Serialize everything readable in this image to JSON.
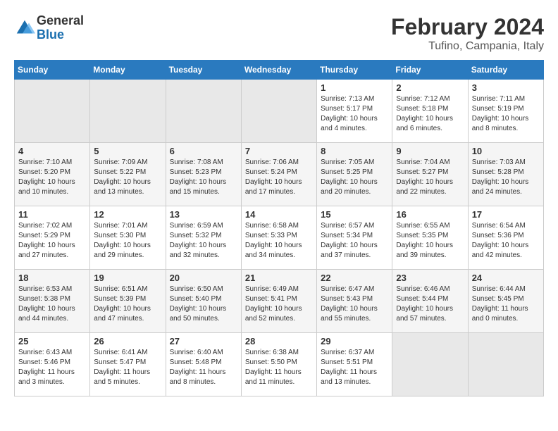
{
  "header": {
    "logo_general": "General",
    "logo_blue": "Blue",
    "main_title": "February 2024",
    "sub_title": "Tufino, Campania, Italy"
  },
  "days_of_week": [
    "Sunday",
    "Monday",
    "Tuesday",
    "Wednesday",
    "Thursday",
    "Friday",
    "Saturday"
  ],
  "weeks": [
    {
      "days": [
        {
          "number": "",
          "info": "",
          "empty": true
        },
        {
          "number": "",
          "info": "",
          "empty": true
        },
        {
          "number": "",
          "info": "",
          "empty": true
        },
        {
          "number": "",
          "info": "",
          "empty": true
        },
        {
          "number": "1",
          "info": "Sunrise: 7:13 AM\nSunset: 5:17 PM\nDaylight: 10 hours\nand 4 minutes."
        },
        {
          "number": "2",
          "info": "Sunrise: 7:12 AM\nSunset: 5:18 PM\nDaylight: 10 hours\nand 6 minutes."
        },
        {
          "number": "3",
          "info": "Sunrise: 7:11 AM\nSunset: 5:19 PM\nDaylight: 10 hours\nand 8 minutes."
        }
      ]
    },
    {
      "days": [
        {
          "number": "4",
          "info": "Sunrise: 7:10 AM\nSunset: 5:20 PM\nDaylight: 10 hours\nand 10 minutes."
        },
        {
          "number": "5",
          "info": "Sunrise: 7:09 AM\nSunset: 5:22 PM\nDaylight: 10 hours\nand 13 minutes."
        },
        {
          "number": "6",
          "info": "Sunrise: 7:08 AM\nSunset: 5:23 PM\nDaylight: 10 hours\nand 15 minutes."
        },
        {
          "number": "7",
          "info": "Sunrise: 7:06 AM\nSunset: 5:24 PM\nDaylight: 10 hours\nand 17 minutes."
        },
        {
          "number": "8",
          "info": "Sunrise: 7:05 AM\nSunset: 5:25 PM\nDaylight: 10 hours\nand 20 minutes."
        },
        {
          "number": "9",
          "info": "Sunrise: 7:04 AM\nSunset: 5:27 PM\nDaylight: 10 hours\nand 22 minutes."
        },
        {
          "number": "10",
          "info": "Sunrise: 7:03 AM\nSunset: 5:28 PM\nDaylight: 10 hours\nand 24 minutes."
        }
      ]
    },
    {
      "days": [
        {
          "number": "11",
          "info": "Sunrise: 7:02 AM\nSunset: 5:29 PM\nDaylight: 10 hours\nand 27 minutes."
        },
        {
          "number": "12",
          "info": "Sunrise: 7:01 AM\nSunset: 5:30 PM\nDaylight: 10 hours\nand 29 minutes."
        },
        {
          "number": "13",
          "info": "Sunrise: 6:59 AM\nSunset: 5:32 PM\nDaylight: 10 hours\nand 32 minutes."
        },
        {
          "number": "14",
          "info": "Sunrise: 6:58 AM\nSunset: 5:33 PM\nDaylight: 10 hours\nand 34 minutes."
        },
        {
          "number": "15",
          "info": "Sunrise: 6:57 AM\nSunset: 5:34 PM\nDaylight: 10 hours\nand 37 minutes."
        },
        {
          "number": "16",
          "info": "Sunrise: 6:55 AM\nSunset: 5:35 PM\nDaylight: 10 hours\nand 39 minutes."
        },
        {
          "number": "17",
          "info": "Sunrise: 6:54 AM\nSunset: 5:36 PM\nDaylight: 10 hours\nand 42 minutes."
        }
      ]
    },
    {
      "days": [
        {
          "number": "18",
          "info": "Sunrise: 6:53 AM\nSunset: 5:38 PM\nDaylight: 10 hours\nand 44 minutes."
        },
        {
          "number": "19",
          "info": "Sunrise: 6:51 AM\nSunset: 5:39 PM\nDaylight: 10 hours\nand 47 minutes."
        },
        {
          "number": "20",
          "info": "Sunrise: 6:50 AM\nSunset: 5:40 PM\nDaylight: 10 hours\nand 50 minutes."
        },
        {
          "number": "21",
          "info": "Sunrise: 6:49 AM\nSunset: 5:41 PM\nDaylight: 10 hours\nand 52 minutes."
        },
        {
          "number": "22",
          "info": "Sunrise: 6:47 AM\nSunset: 5:43 PM\nDaylight: 10 hours\nand 55 minutes."
        },
        {
          "number": "23",
          "info": "Sunrise: 6:46 AM\nSunset: 5:44 PM\nDaylight: 10 hours\nand 57 minutes."
        },
        {
          "number": "24",
          "info": "Sunrise: 6:44 AM\nSunset: 5:45 PM\nDaylight: 11 hours\nand 0 minutes."
        }
      ]
    },
    {
      "days": [
        {
          "number": "25",
          "info": "Sunrise: 6:43 AM\nSunset: 5:46 PM\nDaylight: 11 hours\nand 3 minutes."
        },
        {
          "number": "26",
          "info": "Sunrise: 6:41 AM\nSunset: 5:47 PM\nDaylight: 11 hours\nand 5 minutes."
        },
        {
          "number": "27",
          "info": "Sunrise: 6:40 AM\nSunset: 5:48 PM\nDaylight: 11 hours\nand 8 minutes."
        },
        {
          "number": "28",
          "info": "Sunrise: 6:38 AM\nSunset: 5:50 PM\nDaylight: 11 hours\nand 11 minutes."
        },
        {
          "number": "29",
          "info": "Sunrise: 6:37 AM\nSunset: 5:51 PM\nDaylight: 11 hours\nand 13 minutes."
        },
        {
          "number": "",
          "info": "",
          "empty": true
        },
        {
          "number": "",
          "info": "",
          "empty": true
        }
      ]
    }
  ]
}
